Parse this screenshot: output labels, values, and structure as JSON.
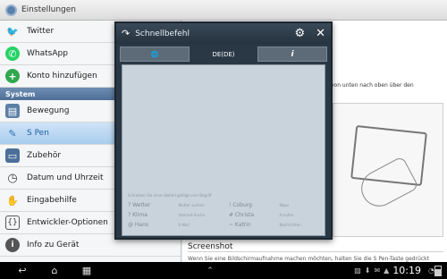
{
  "titlebar": {
    "title": "Einstellungen"
  },
  "sidebar": {
    "items": [
      {
        "label": "Twitter",
        "icon": "twitter-icon",
        "color": "#1da1f2",
        "glyph": "🐦"
      },
      {
        "label": "WhatsApp",
        "icon": "whatsapp-icon",
        "color": "#25d366",
        "glyph": "✆"
      },
      {
        "label": "Konto hinzufügen",
        "icon": "add-account-icon",
        "color": "#2fa84f",
        "glyph": "+"
      }
    ],
    "section": "System",
    "system_items": [
      {
        "label": "Bewegung",
        "icon": "motion-icon",
        "glyph": "▤"
      },
      {
        "label": "S Pen",
        "icon": "s-pen-icon",
        "glyph": "✎",
        "selected": true
      },
      {
        "label": "Zubehör",
        "icon": "accessory-icon",
        "glyph": "▭"
      },
      {
        "label": "Datum und Uhrzeit",
        "icon": "clock-icon",
        "glyph": "◷"
      },
      {
        "label": "Eingabehilfe",
        "icon": "hand-icon",
        "glyph": "✋"
      },
      {
        "label": "Entwickler-Optionen",
        "icon": "developer-icon",
        "glyph": "{}"
      },
      {
        "label": "Info zu Gerät",
        "icon": "info-icon",
        "glyph": "i"
      }
    ]
  },
  "content": {
    "hint": "von unten nach oben über den",
    "section_title": "Screenshot",
    "section_text": "Wenn Sie eine Bildschirmaufnahme machen möchten, halten Sie die S Pen-Taste gedrückt"
  },
  "popup": {
    "title": "Schnellbefehl",
    "tabs": {
      "left": "🌐",
      "middle": "DE(DE)",
      "right": "i"
    },
    "pad_rows": [
      [
        "Schreiben Sie einen Befehl gefolgt vom Begriff",
        "",
        "",
        ""
      ],
      [
        "? Wetter",
        "Wetter suchen",
        "! Coburg",
        "Maps"
      ],
      [
        "? Klima",
        "Internet-Suche",
        "# Christa",
        "Anrufen"
      ],
      [
        "@ Hans",
        "E-Mail",
        "~ Katrin",
        "Nachrichten"
      ]
    ]
  },
  "navbar": {
    "back": "↩",
    "home": "⌂",
    "recent": "▦",
    "up": "⌃",
    "status": [
      "▨",
      "⬇",
      "✉",
      "▲",
      "◔"
    ],
    "time": "10:19"
  }
}
